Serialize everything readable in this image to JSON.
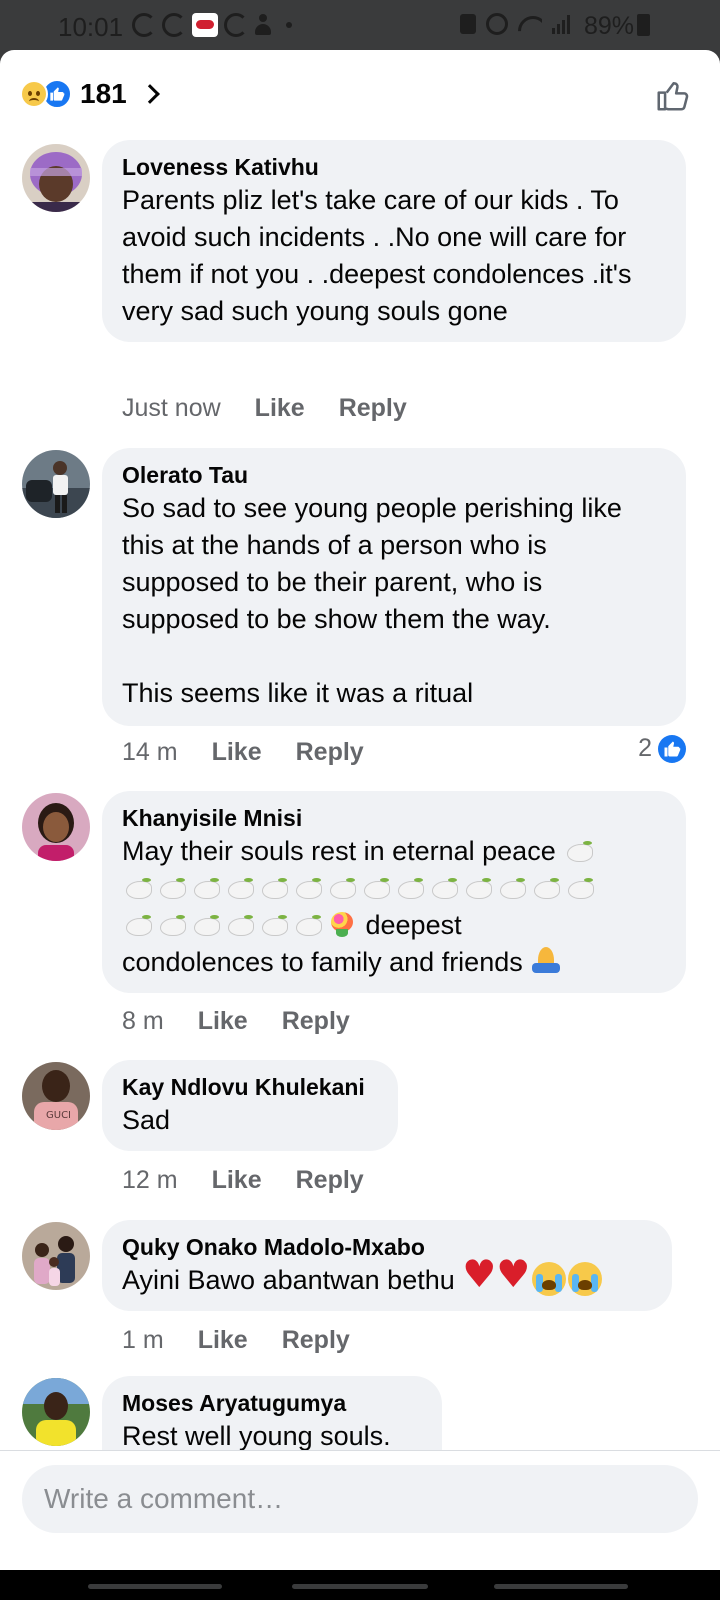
{
  "status_bar": {
    "time": "10:01",
    "battery": "89%",
    "left_icons": [
      "sync-icon",
      "sync-icon",
      "app-notification-icon",
      "sync-icon",
      "person-icon",
      "dot-icon"
    ],
    "right_icons": [
      "lock-icon",
      "alarm-icon",
      "wifi-icon",
      "signal-icon",
      "battery-icon"
    ]
  },
  "header": {
    "reaction_count": "181",
    "reaction_types": [
      "sad",
      "like"
    ],
    "like_icon": "thumbs-up-icon"
  },
  "comments": [
    {
      "author": "Loveness Kativhu",
      "text": "Parents pliz let's take care of our kids . To avoid such incidents . .No one will care for them if not you . .deepest condolences .it's very sad such young souls gone",
      "time": "Just now",
      "like": "Like",
      "reply": "Reply"
    },
    {
      "author": "Olerato Tau",
      "text": "So sad to see young people perishing like this at the hands of a person who is supposed to be their parent, who is supposed to be show them the way.\n\nThis seems like it was a ritual",
      "time": "14 m",
      "like": "Like",
      "reply": "Reply",
      "reactions": "2"
    },
    {
      "author": "Khanyisile Mnisi",
      "text_start": "May their souls rest in eternal peace",
      "text_deepest": " deepest",
      "text_end": "condolences to family and friends ",
      "emojis": [
        "dove x21",
        "bouquet",
        "folded-hands"
      ],
      "time": "8 m",
      "like": "Like",
      "reply": "Reply"
    },
    {
      "author": "Kay Ndlovu Khulekani",
      "text": "Sad",
      "time": "12 m",
      "like": "Like",
      "reply": "Reply"
    },
    {
      "author": "Quky Onako Madolo-Mxabo",
      "text": "Ayini Bawo abantwan bethu ",
      "emojis": [
        "broken-heart",
        "broken-heart",
        "loudly-crying-face",
        "loudly-crying-face"
      ],
      "time": "1 m",
      "like": "Like",
      "reply": "Reply"
    },
    {
      "author": "Moses Aryatugumya",
      "text": "Rest well young souls."
    }
  ],
  "composer": {
    "placeholder": "Write a comment…"
  },
  "colors": {
    "accent": "#1877f2",
    "bubble": "#f0f2f5",
    "meta": "#65676b",
    "statusbar": "#3a3b3c"
  }
}
